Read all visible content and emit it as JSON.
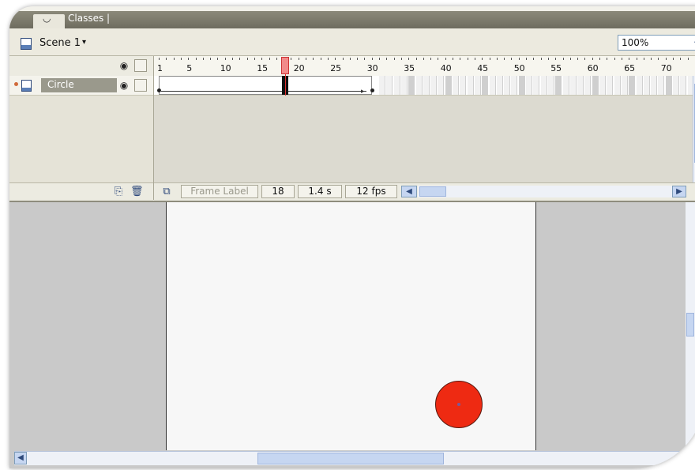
{
  "tabs": {
    "first_glyph": "",
    "classes": "Classes  |"
  },
  "scene": {
    "label": "Scene 1",
    "caret": "▾"
  },
  "zoom": {
    "value": "100%",
    "caret": "⌄"
  },
  "timeline": {
    "header_icons": {
      "eye": "eye-icon",
      "lock": "lock-icon"
    },
    "layer": {
      "name": "Circle",
      "icon": "layer-icon"
    },
    "ruler_numbers": [
      "1",
      "5",
      "10",
      "15",
      "20",
      "25",
      "30",
      "35",
      "40",
      "45",
      "50",
      "55",
      "60",
      "65",
      "70"
    ],
    "current_frame": "18",
    "elapsed": "1.4 s",
    "frame_rate": "12 fps",
    "frame_label": "Frame Label",
    "tween_start_frame": 1,
    "tween_end_frame": 30,
    "footer_icons": [
      "add-layer-icon",
      "delete-layer-icon",
      "center-frame-icon"
    ]
  },
  "stage": {
    "shape": "circle",
    "fill": "#ee2a12"
  }
}
